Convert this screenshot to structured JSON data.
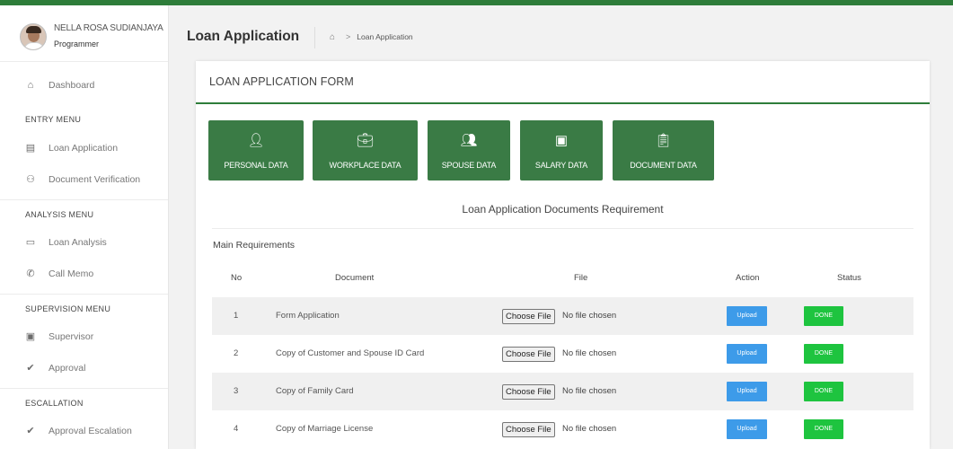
{
  "sidebar": {
    "user_name": "NELLA ROSA SUDIANJAYA",
    "user_role": "Programmer",
    "dashboard": "Dashboard",
    "entry_menu": "ENTRY MENU",
    "loan_application": "Loan Application",
    "document_verification": "Document Verification",
    "analysis_menu": "ANALYSIS MENU",
    "loan_analysis": "Loan Analysis",
    "call_memo": "Call Memo",
    "supervision_menu": "SUPERVISION MENU",
    "supervisor": "Supervisor",
    "approval": "Approval",
    "escallation": "ESCALLATION",
    "approval_escalation": "Approval Escalation"
  },
  "header": {
    "title": "Loan Application",
    "breadcrumb": "Loan Application"
  },
  "card": {
    "title": "LOAN APPLICATION FORM"
  },
  "tabs": [
    {
      "label": "PERSONAL DATA",
      "icon": "user-icon"
    },
    {
      "label": "WORKPLACE DATA",
      "icon": "briefcase-icon"
    },
    {
      "label": "SPOUSE DATA",
      "icon": "users-icon"
    },
    {
      "label": "SALARY DATA",
      "icon": "money-icon"
    },
    {
      "label": "DOCUMENT DATA",
      "icon": "clipboard-icon"
    }
  ],
  "requirements": {
    "title": "Loan Application Documents Requirement",
    "section": "Main Requirements",
    "headers": {
      "no": "No",
      "document": "Document",
      "file": "File",
      "action": "Action",
      "status": "Status"
    },
    "rows": [
      {
        "no": "1",
        "document": "Form Application",
        "choose": "Choose File",
        "file": "No file chosen",
        "action": "Upload",
        "status": "DONE"
      },
      {
        "no": "2",
        "document": "Copy of Customer and Spouse ID Card",
        "choose": "Choose File",
        "file": "No file chosen",
        "action": "Upload",
        "status": "DONE"
      },
      {
        "no": "3",
        "document": "Copy of Family Card",
        "choose": "Choose File",
        "file": "No file chosen",
        "action": "Upload",
        "status": "DONE"
      },
      {
        "no": "4",
        "document": "Copy of Marriage License",
        "choose": "Choose File",
        "file": "No file chosen",
        "action": "Upload",
        "status": "DONE"
      }
    ]
  },
  "colors": {
    "accent": "#2e7d3a",
    "tab_bg": "#3a7b45",
    "upload": "#3d9be9",
    "done": "#1ec43f"
  }
}
